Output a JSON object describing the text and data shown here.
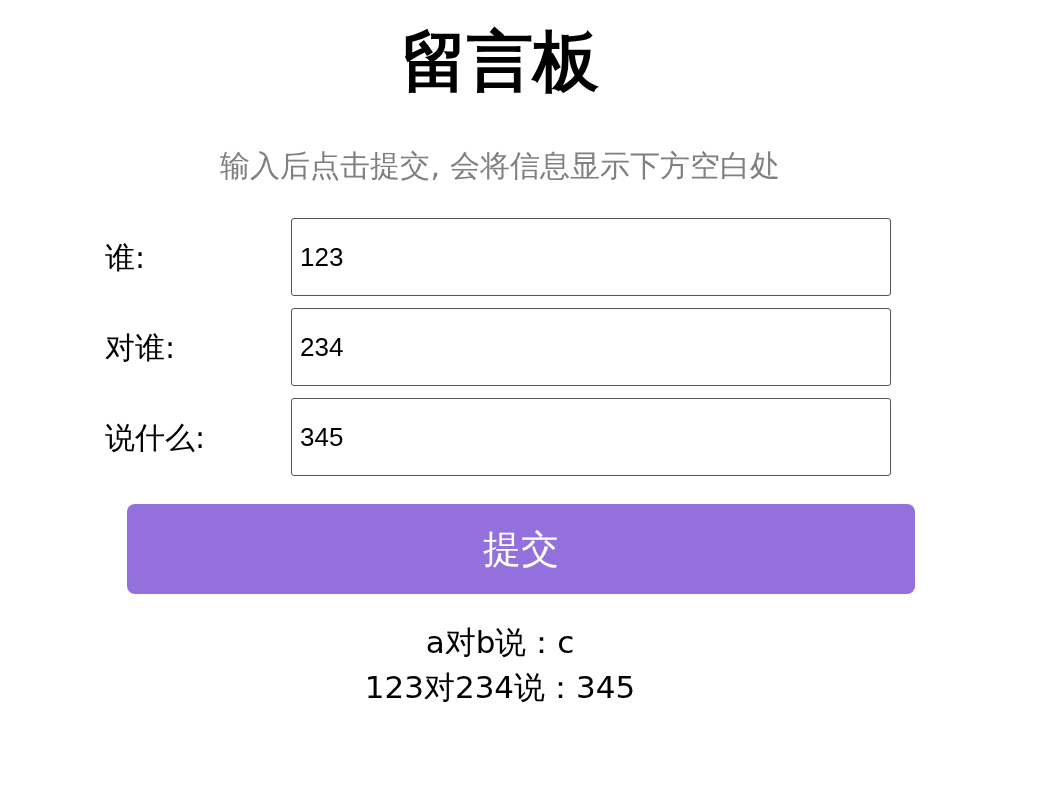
{
  "title": "留言板",
  "subtitle": "输入后点击提交, 会将信息显示下方空白处",
  "fields": [
    {
      "label": "谁:",
      "value": "123"
    },
    {
      "label": "对谁:",
      "value": "234"
    },
    {
      "label": "说什么:",
      "value": "345"
    }
  ],
  "submit_button": "提交",
  "messages": [
    "a对b说：c",
    "123对234说：345"
  ]
}
